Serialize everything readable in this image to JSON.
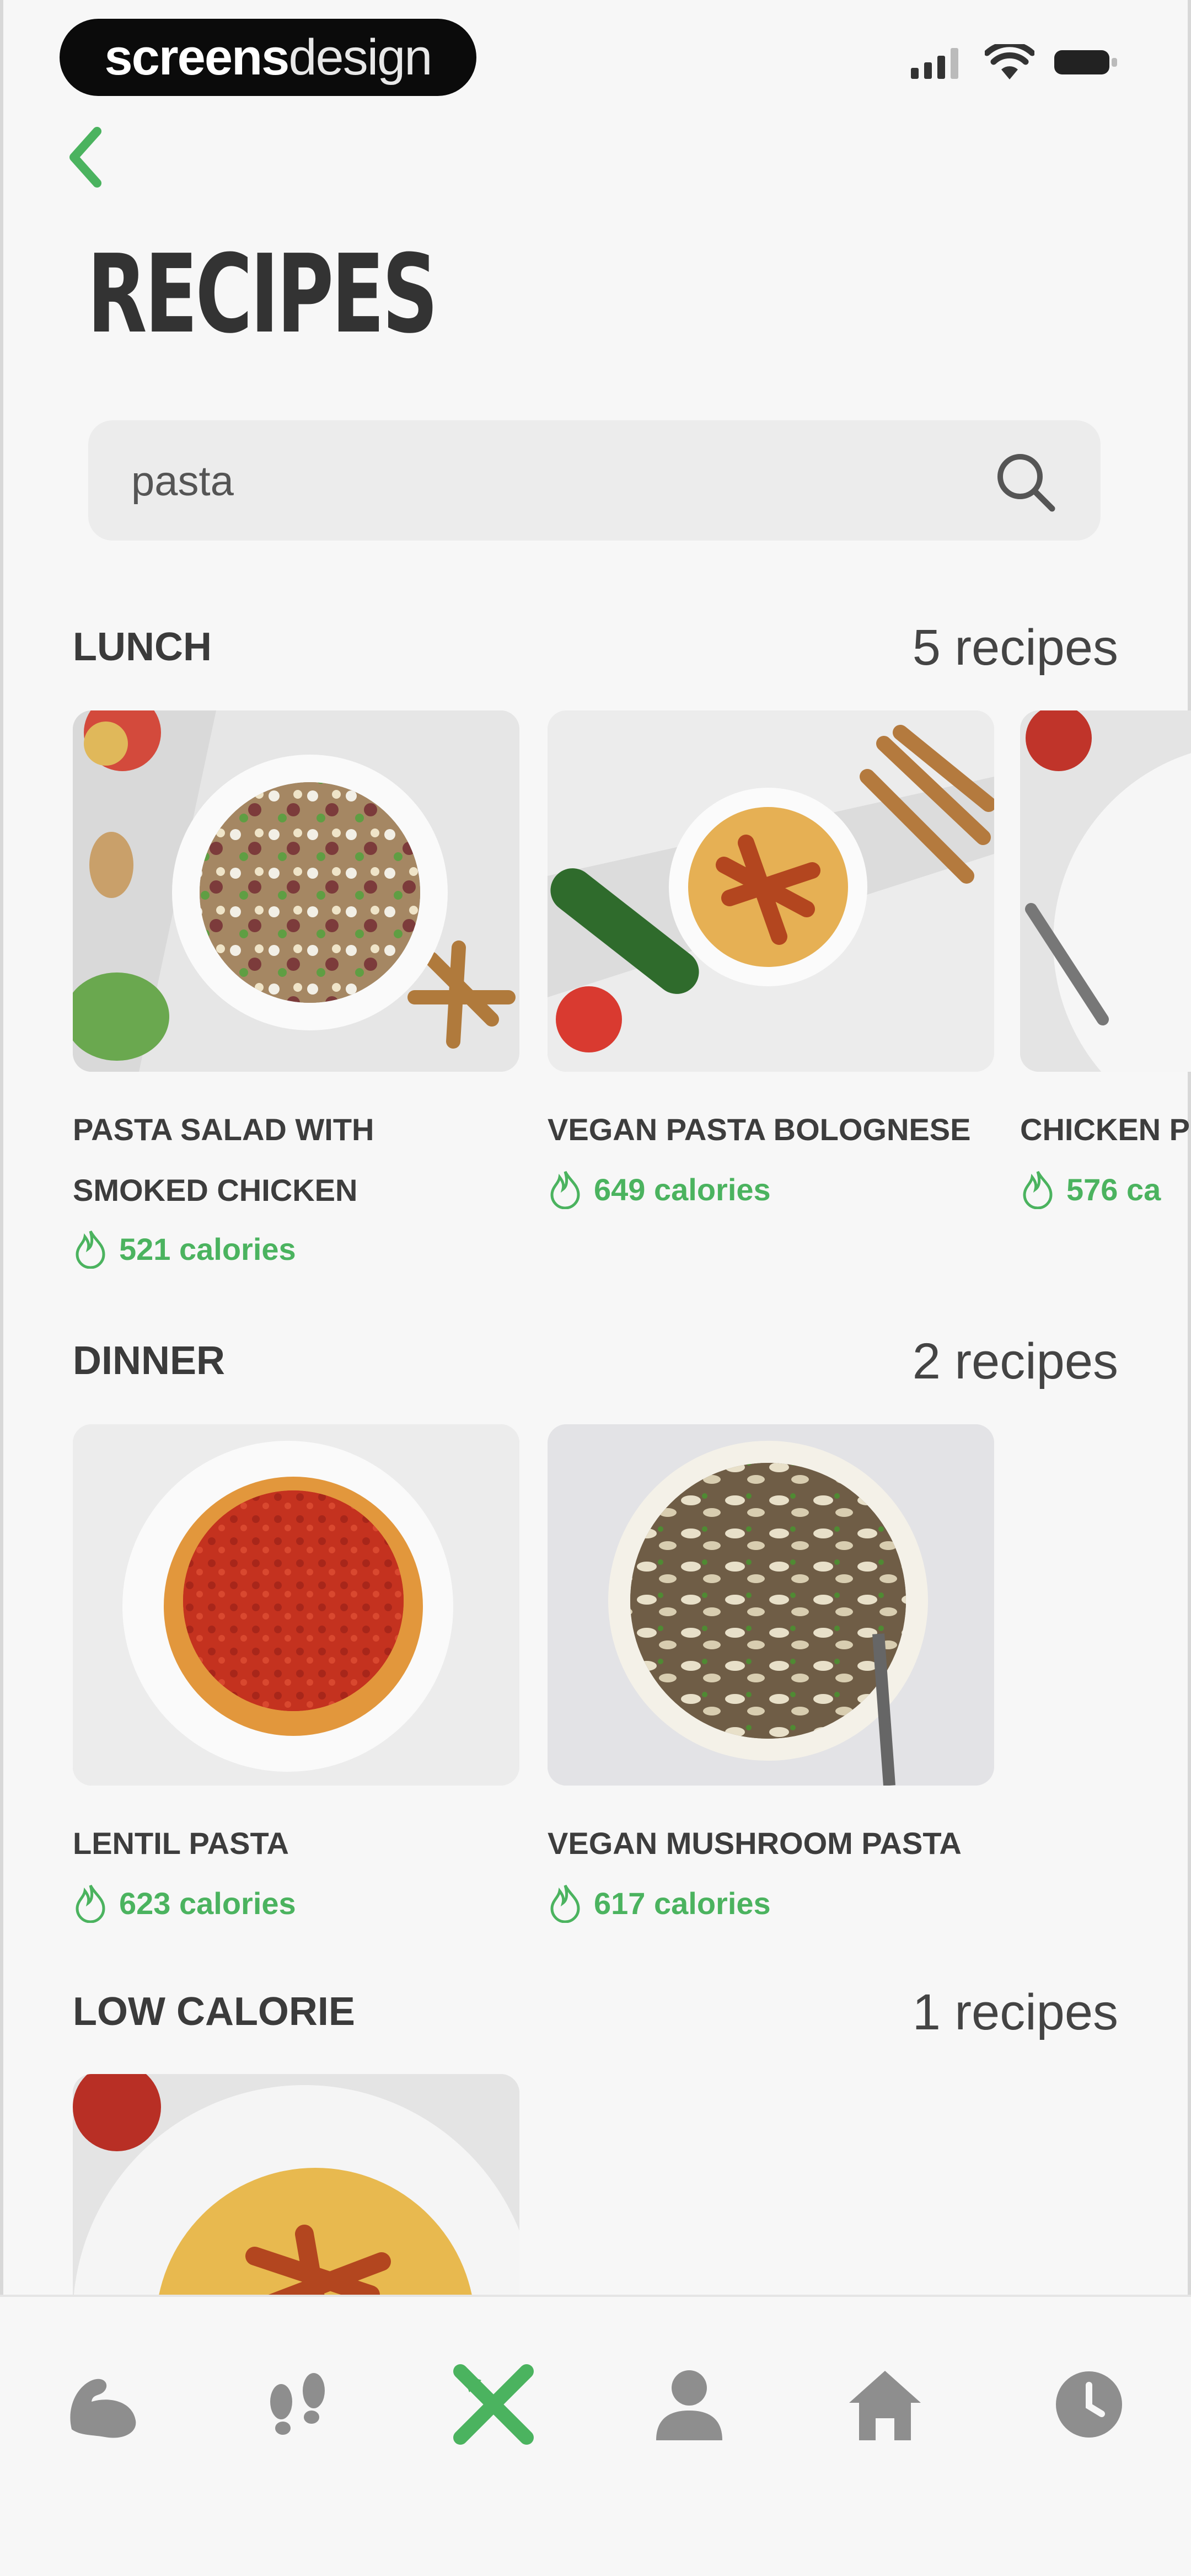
{
  "brand": {
    "bold": "screens",
    "light": "design"
  },
  "status": {
    "signal_icon": "signal-icon",
    "wifi_icon": "wifi-icon",
    "battery_icon": "battery-icon"
  },
  "header": {
    "back_icon": "chevron-left-icon",
    "title": "RECIPES"
  },
  "search": {
    "value": "pasta",
    "icon": "search-icon"
  },
  "sections": [
    {
      "title": "LUNCH",
      "count": "5 recipes",
      "cards": [
        {
          "name_lines": [
            "PASTA SALAD WITH",
            "SMOKED CHICKEN"
          ],
          "calories": "521 calories"
        },
        {
          "name_lines": [
            "VEGAN PASTA BOLOGNESE"
          ],
          "calories": "649 calories"
        },
        {
          "name_lines": [
            "CHICKEN P"
          ],
          "calories": "576 ca"
        }
      ]
    },
    {
      "title": "DINNER",
      "count": "2 recipes",
      "cards": [
        {
          "name_lines": [
            "LENTIL PASTA"
          ],
          "calories": "623 calories"
        },
        {
          "name_lines": [
            "VEGAN MUSHROOM PASTA"
          ],
          "calories": "617 calories"
        }
      ]
    },
    {
      "title": "LOW CALORIE",
      "count": "1 recipes",
      "cards": []
    }
  ],
  "tabbar": {
    "items": [
      {
        "icon": "flexed-arm-icon",
        "active": false
      },
      {
        "icon": "footsteps-icon",
        "active": false
      },
      {
        "icon": "fork-knife-cross-icon",
        "active": true
      },
      {
        "icon": "person-icon",
        "active": false
      },
      {
        "icon": "home-icon",
        "active": false
      },
      {
        "icon": "history-clock-icon",
        "active": false
      }
    ]
  },
  "colors": {
    "accent": "#4bb35f",
    "background": "#f7f7f7",
    "search_bg": "#ececec",
    "inactive_icon": "#8e8e8e"
  }
}
